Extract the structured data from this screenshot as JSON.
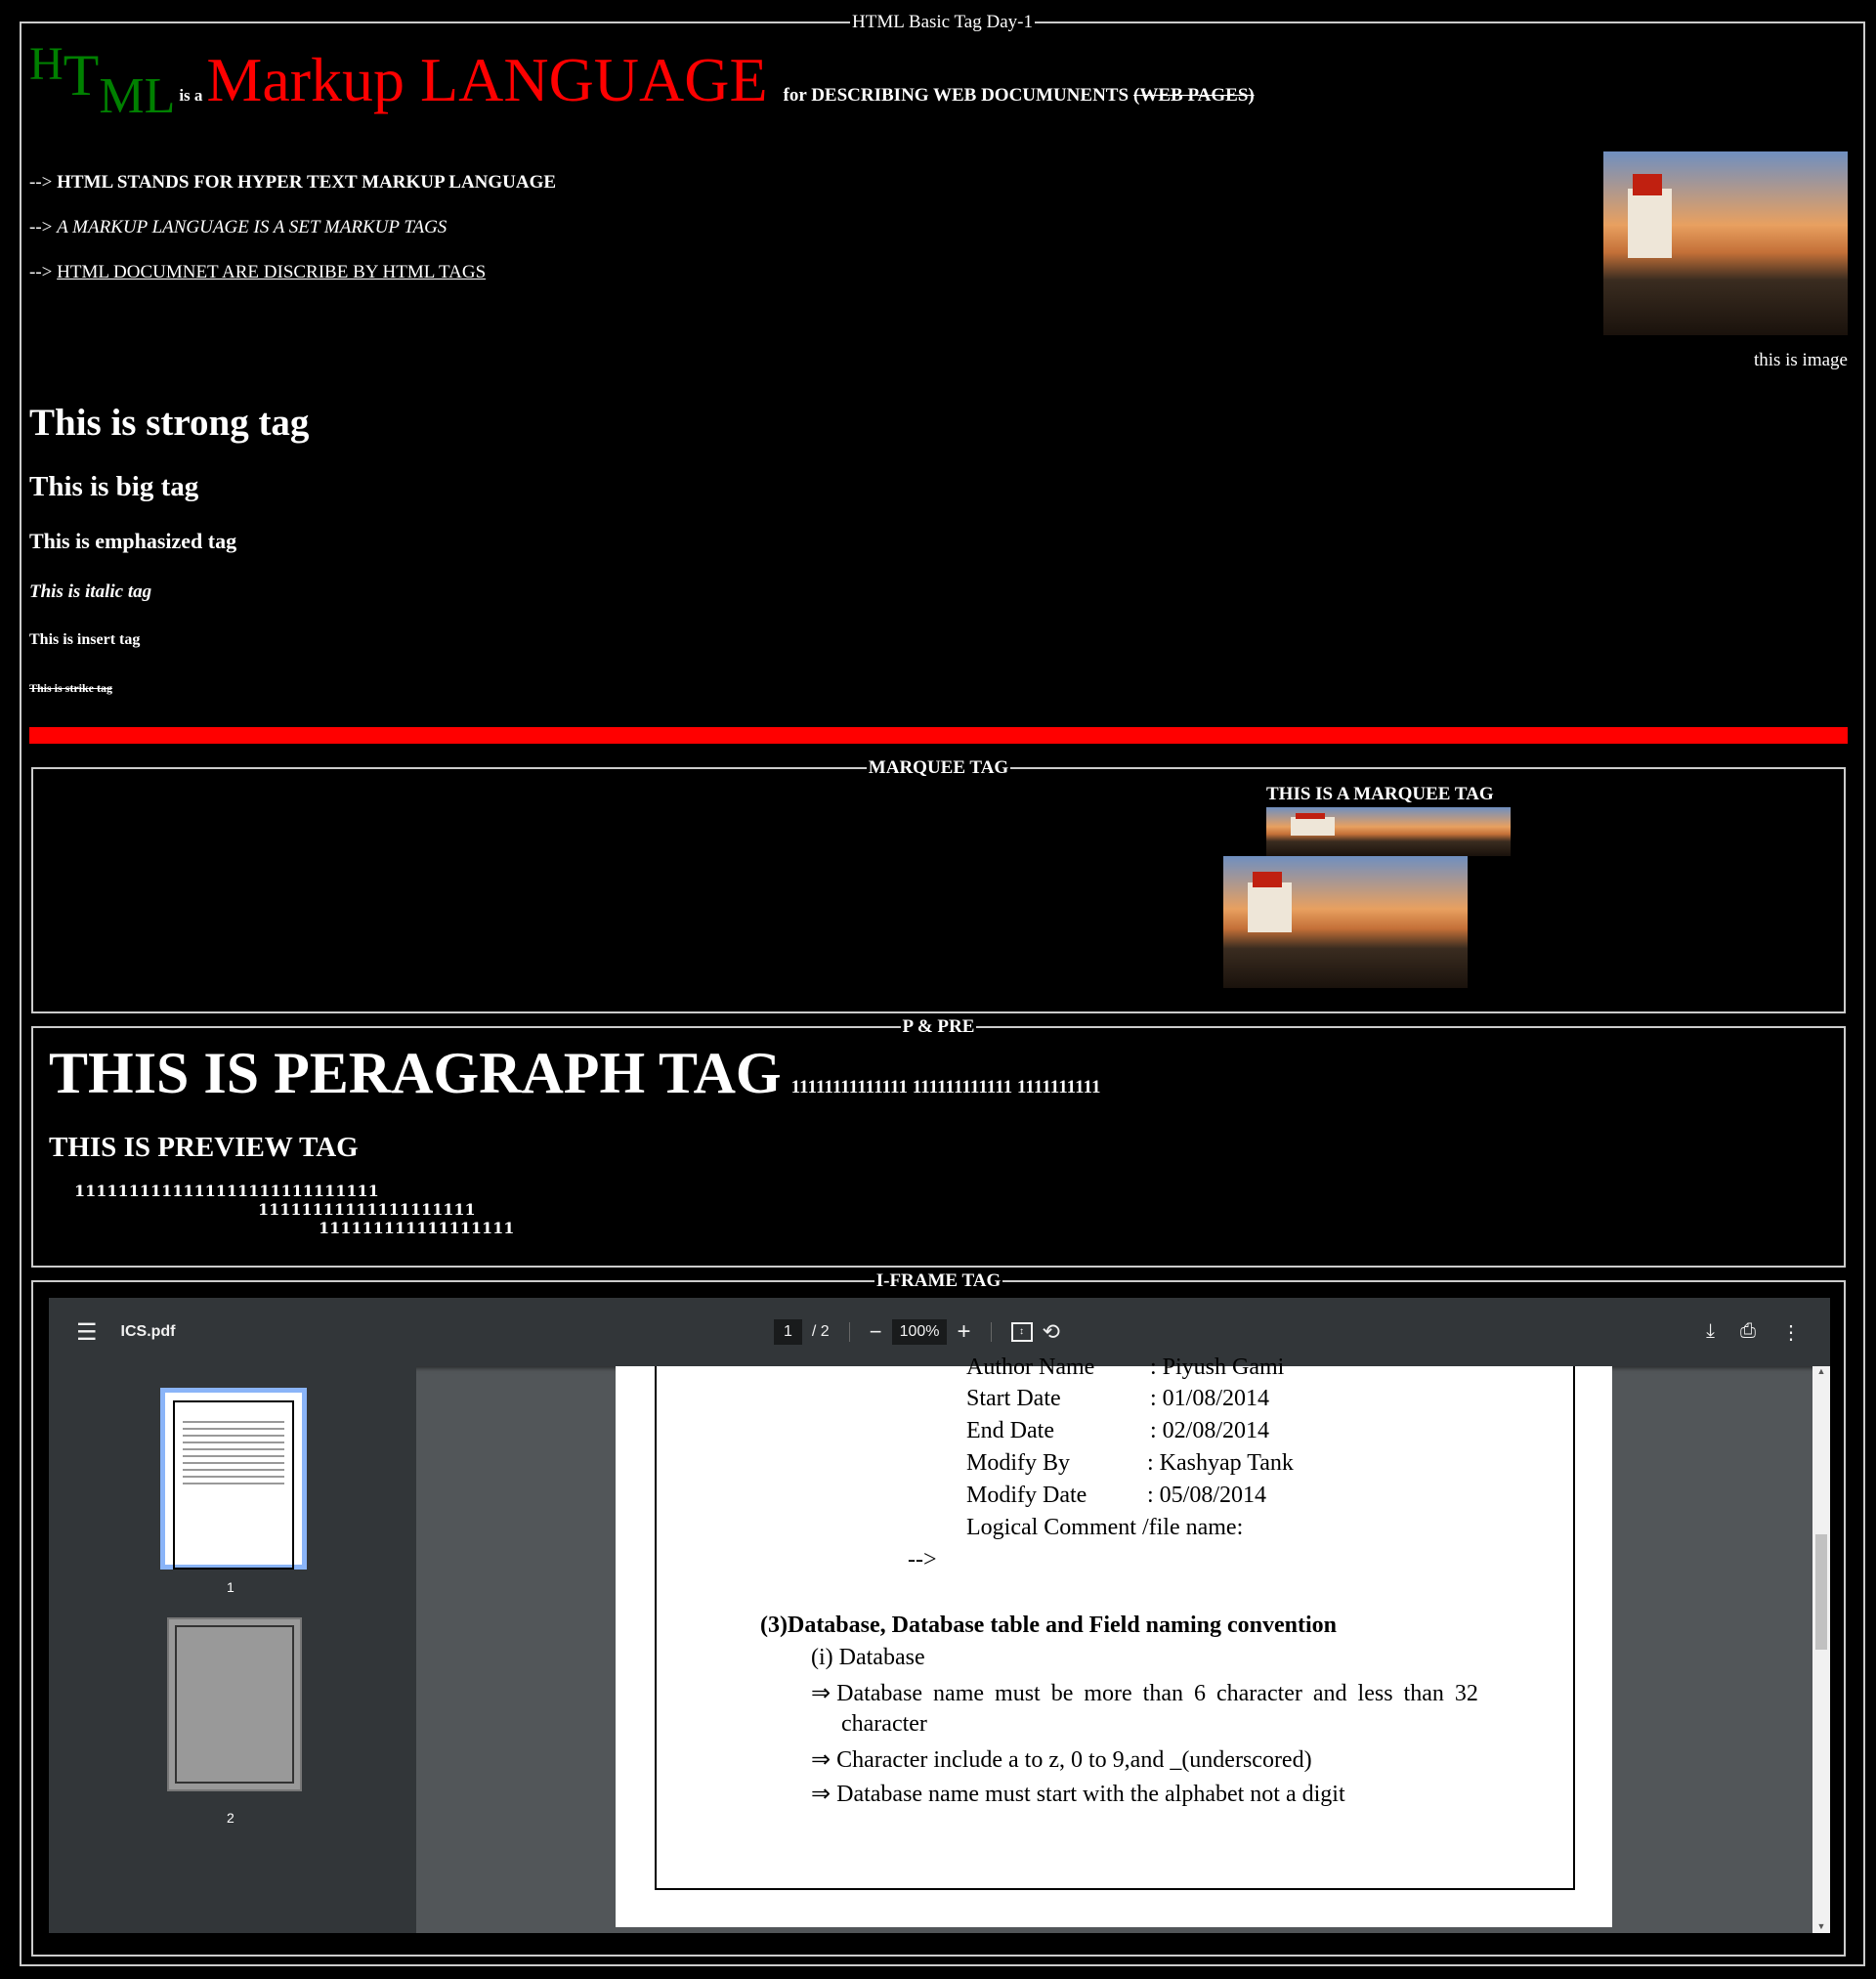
{
  "legend_main": "HTML Basic Tag Day-1",
  "heading": {
    "h": "H",
    "t": "T",
    "ml": "ML",
    "is_a": "is a",
    "markup": "Markup LANGUAGE",
    "for_desc": "for DESCRIBING WEB DOCUMUNENTS",
    "struck": "(WEB PAGES)",
    "colors": {
      "green": "#008000",
      "red": "#ff0000"
    }
  },
  "list": [
    {
      "arrow": "-->",
      "text": "HTML STANDS FOR HYPER TEXT MARKUP LANGUAGE"
    },
    {
      "arrow": "-->",
      "text": "A MARKUP LANGUAGE IS A SET MARKUP TAGS"
    },
    {
      "arrow": "-->",
      "text": "HTML DOCUMNET ARE DISCRIBE BY HTML TAGS"
    }
  ],
  "image_caption": "this is image",
  "tags": {
    "strong": "This is strong tag",
    "big": "This is big tag",
    "em": "This is emphasized tag",
    "italic": "This is italic tag",
    "insert": "This is insert tag",
    "strike": "This is strike tag"
  },
  "marquee": {
    "legend": "MARQUEE TAG",
    "text": "THIS IS A MARQUEE TAG"
  },
  "ppre": {
    "legend": "P & PRE",
    "para": "THIS IS PERAGRAPH TAG",
    "para_small": "11111111111111 111111111111 1111111111",
    "pre_head": "THIS IS PREVIEW TAG",
    "pre_lines": [
      "1111111111111111111111111111",
      "11111111111111111111",
      "111111111111111111"
    ]
  },
  "iframe": {
    "legend": "I-FRAME TAG",
    "file": "ICS.pdf",
    "page": "1",
    "total": "/  2",
    "zoom": "100%",
    "thumb_labels": [
      "1",
      "2"
    ],
    "doc": {
      "rows": [
        [
          "Author Name",
          ": Piyush Gami"
        ],
        [
          "Start Date",
          ": 01/08/2014"
        ],
        [
          "End Date",
          ": 02/08/2014"
        ],
        [
          "Modify By",
          ": Kashyap Tank"
        ],
        [
          "Modify Date",
          ": 05/08/2014"
        ]
      ],
      "logical": "Logical Comment /file name:",
      "arrow": "-->",
      "section": "(3)Database, Database  table and Field naming convention",
      "sub": "(i) Database",
      "bullets": [
        "Database name must be more than 6 character and less than 32",
        "character",
        "Character include a to z, 0 to 9,and _(underscored)",
        "Database name must start with the alphabet not a digit"
      ],
      "bullet_sym": "⇒"
    }
  }
}
